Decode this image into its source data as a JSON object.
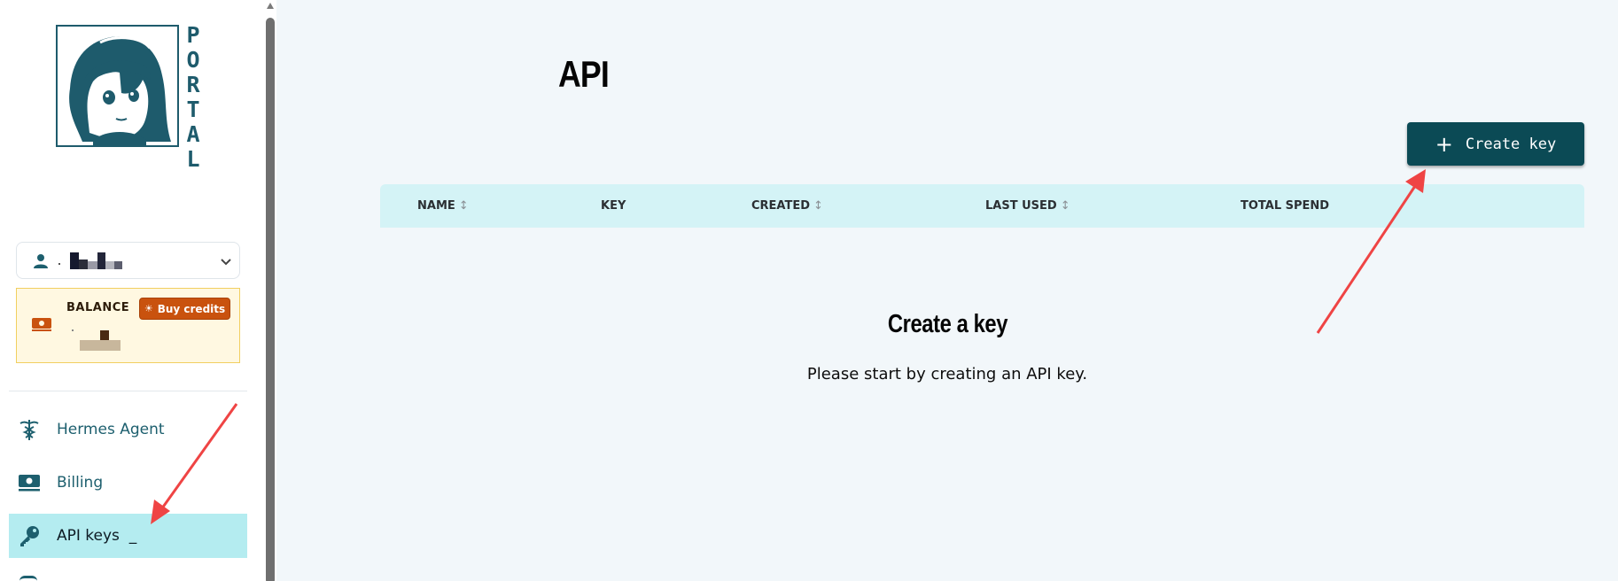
{
  "sidebar": {
    "logo_text": "PORTAL",
    "balance_label": "BALANCE",
    "buy_credits_label": "Buy credits",
    "nav_items": [
      {
        "label": "Hermes Agent",
        "icon": "caduceus-icon"
      },
      {
        "label": "Billing",
        "icon": "cash-icon"
      },
      {
        "label": "API keys",
        "icon": "key-icon",
        "active": true,
        "cursor": "_"
      }
    ]
  },
  "main": {
    "title": "API",
    "create_key_label": "Create key",
    "table_headers": [
      {
        "label": "NAME",
        "sortable": true
      },
      {
        "label": "KEY",
        "sortable": false
      },
      {
        "label": "CREATED",
        "sortable": true
      },
      {
        "label": "LAST USED",
        "sortable": true
      },
      {
        "label": "TOTAL SPEND",
        "sortable": false
      }
    ],
    "empty_state": {
      "title": "Create a key",
      "message": "Please start by creating an API key."
    }
  },
  "colors": {
    "accent_dark": "#0b4a55",
    "nav_active_bg": "#b4ecf0",
    "table_header_bg": "#d4f3f6",
    "buy_button": "#c9520e",
    "balance_bg": "#fff8e1",
    "annotation_arrow": "#ef4444"
  }
}
